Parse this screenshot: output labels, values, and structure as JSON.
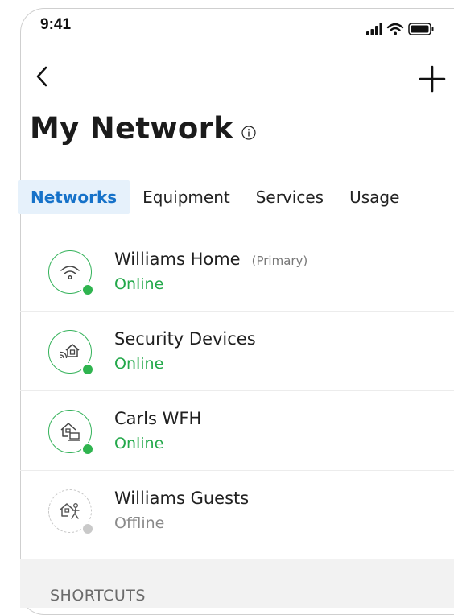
{
  "status_bar": {
    "time": "9:41"
  },
  "header": {
    "title": "My Network"
  },
  "tabs": [
    {
      "label": "Networks",
      "active": true
    },
    {
      "label": "Equipment",
      "active": false
    },
    {
      "label": "Services",
      "active": false
    },
    {
      "label": "Usage",
      "active": false
    }
  ],
  "networks": [
    {
      "name": "Williams Home",
      "tag": "(Primary)",
      "status": "Online",
      "icon": "wifi-icon"
    },
    {
      "name": "Security Devices",
      "tag": "",
      "status": "Online",
      "icon": "security-home-icon"
    },
    {
      "name": "Carls WFH",
      "tag": "",
      "status": "Online",
      "icon": "home-office-icon"
    },
    {
      "name": "Williams Guests",
      "tag": "",
      "status": "Offline",
      "icon": "guest-home-icon"
    }
  ],
  "shortcuts": {
    "label": "SHORTCUTS"
  },
  "colors": {
    "accent": "#1672c9",
    "online": "#23a84a",
    "offline": "#8a8a8a",
    "tab_active_bg": "#e6f1fb"
  }
}
